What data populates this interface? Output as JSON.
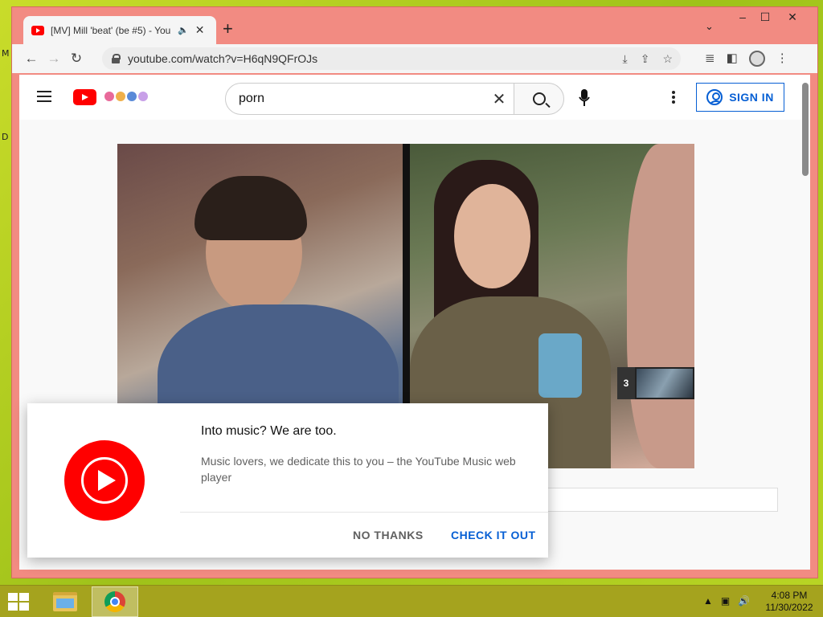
{
  "browser": {
    "tab_title": "[MV] Mill 'beat' (be #5) - You",
    "url": "youtube.com/watch?v=H6qN9QFrOJs",
    "new_tab_label": "+",
    "back_label": "←",
    "forward_label": "→",
    "reload_label": "↻"
  },
  "youtube": {
    "search_query": "porn",
    "sign_in_label": "SIGN IN",
    "endcard_number": "3"
  },
  "promo": {
    "title": "Into music? We are too.",
    "body": "Music lovers, we dedicate this to you – the YouTube Music web player",
    "no_thanks_label": "NO THANKS",
    "check_it_out_label": "CHECK IT OUT"
  },
  "taskbar": {
    "time": "4:08 PM",
    "date": "11/30/2022"
  },
  "desktop": {
    "fragment_top": "M",
    "fragment_mid": "D"
  },
  "colors": {
    "window_frame": "#f28b82",
    "youtube_red": "#ff0000",
    "link_blue": "#065fd4",
    "taskbar": "#a5a31e"
  }
}
